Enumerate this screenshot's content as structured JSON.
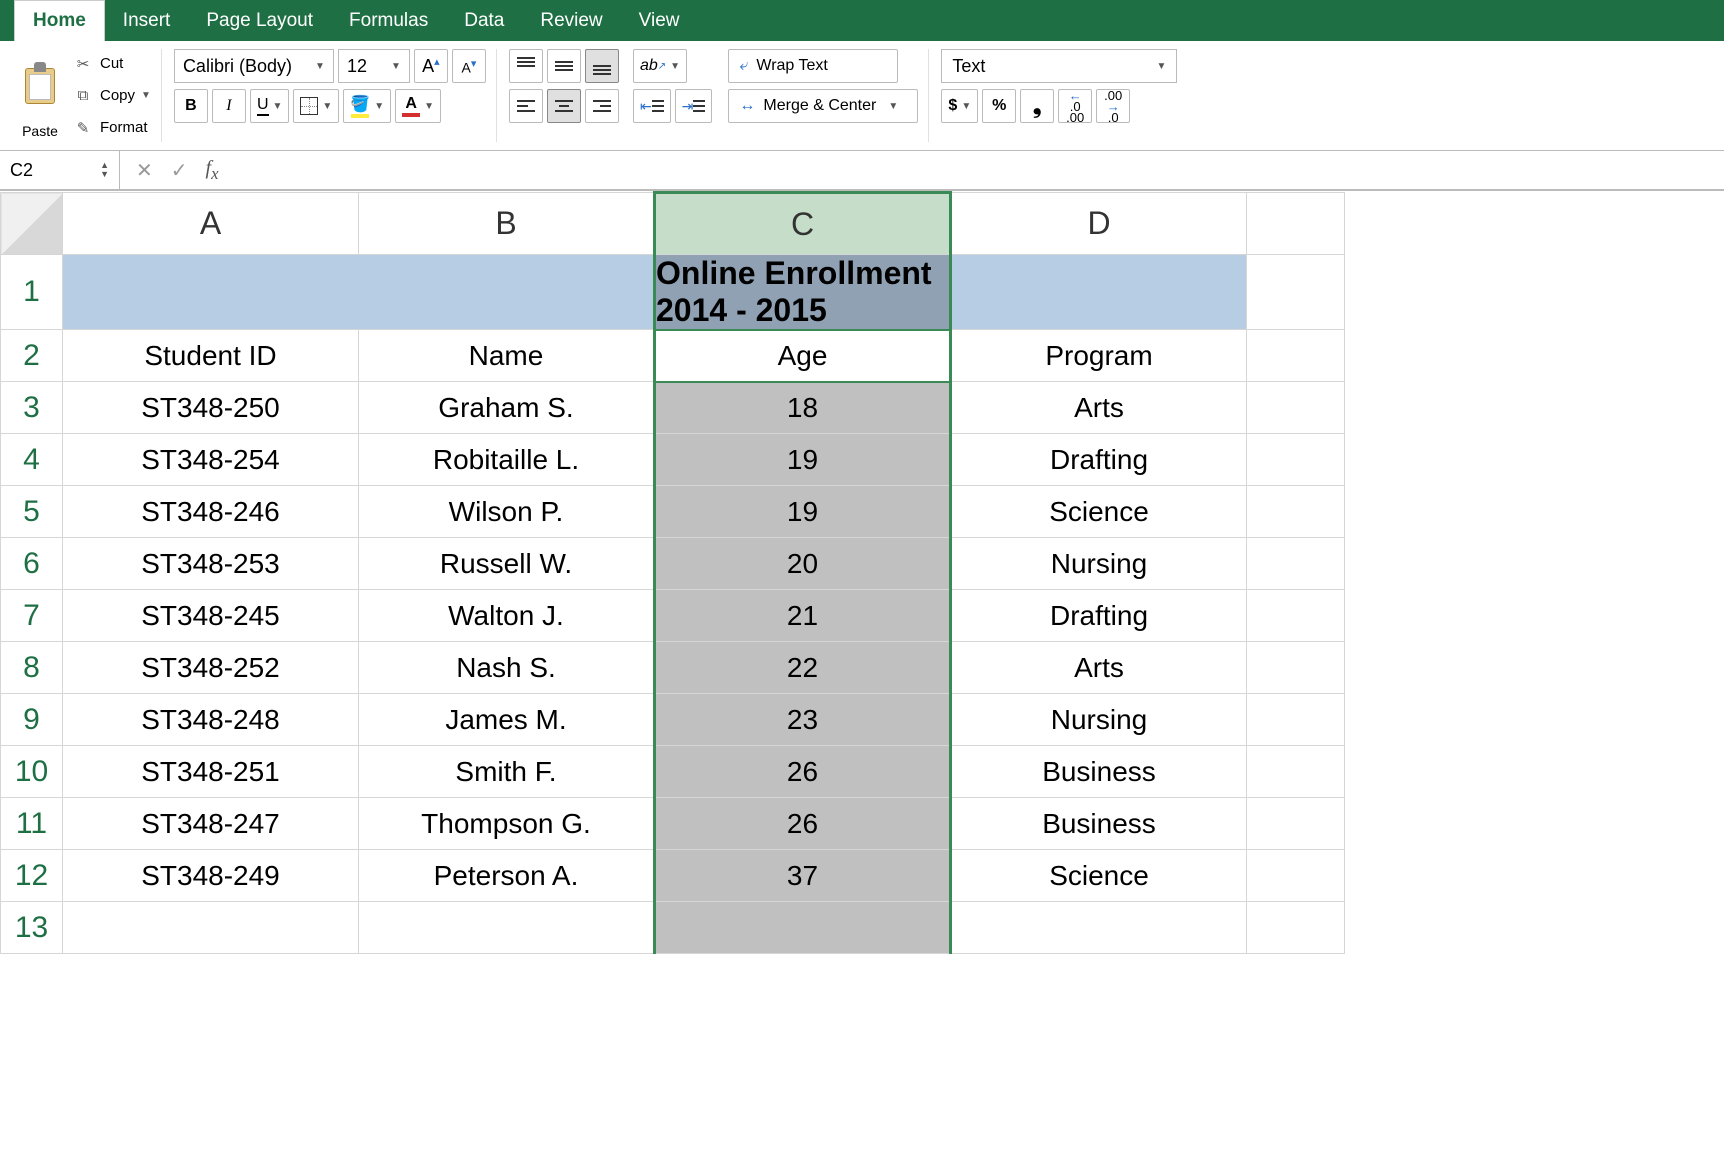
{
  "tabs": [
    "Home",
    "Insert",
    "Page Layout",
    "Formulas",
    "Data",
    "Review",
    "View"
  ],
  "activeTab": "Home",
  "clipboard": {
    "paste": "Paste",
    "cut": "Cut",
    "copy": "Copy",
    "format": "Format"
  },
  "font": {
    "name": "Calibri (Body)",
    "size": "12"
  },
  "wrap": "Wrap Text",
  "merge": "Merge & Center",
  "numberFormat": "Text",
  "nameBox": "C2",
  "formula": "",
  "columns": [
    "A",
    "B",
    "C",
    "D"
  ],
  "selectedColumn": "C",
  "title": "Online Enrollment 2014 - 2015",
  "headers": {
    "a": "Student ID",
    "b": "Name",
    "c": "Age",
    "d": "Program"
  },
  "rows": [
    {
      "a": "ST348-250",
      "b": "Graham S.",
      "c": "18",
      "d": "Arts"
    },
    {
      "a": "ST348-254",
      "b": "Robitaille L.",
      "c": "19",
      "d": "Drafting"
    },
    {
      "a": "ST348-246",
      "b": "Wilson P.",
      "c": "19",
      "d": "Science"
    },
    {
      "a": "ST348-253",
      "b": "Russell W.",
      "c": "20",
      "d": "Nursing"
    },
    {
      "a": "ST348-245",
      "b": "Walton J.",
      "c": "21",
      "d": "Drafting"
    },
    {
      "a": "ST348-252",
      "b": "Nash S.",
      "c": "22",
      "d": "Arts"
    },
    {
      "a": "ST348-248",
      "b": "James M.",
      "c": "23",
      "d": "Nursing"
    },
    {
      "a": "ST348-251",
      "b": "Smith F.",
      "c": "26",
      "d": "Business"
    },
    {
      "a": "ST348-247",
      "b": "Thompson G.",
      "c": "26",
      "d": "Business"
    },
    {
      "a": "ST348-249",
      "b": "Peterson A.",
      "c": "37",
      "d": "Science"
    }
  ]
}
